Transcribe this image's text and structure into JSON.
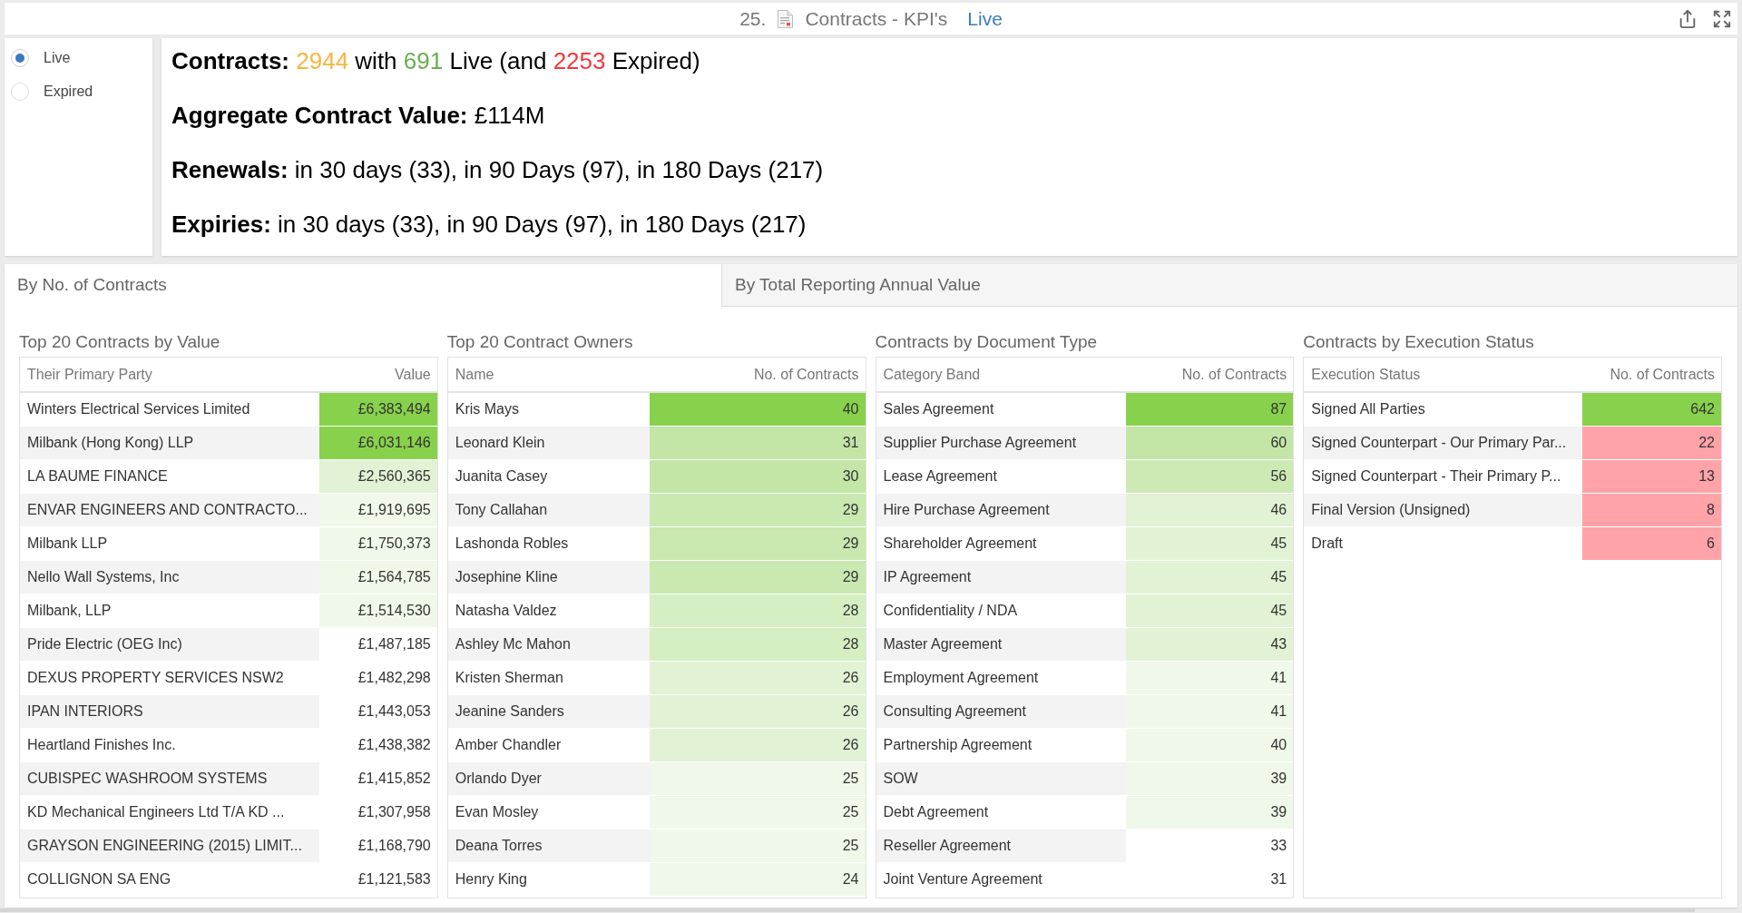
{
  "title_bar": {
    "number": "25.",
    "title": "Contracts - KPI's",
    "status": "Live"
  },
  "filter": {
    "options": [
      {
        "label": "Live",
        "selected": true
      },
      {
        "label": "Expired",
        "selected": false
      }
    ]
  },
  "kpis": [
    {
      "label": "Contracts:",
      "segments": [
        {
          "text": "2944",
          "color": "#fab43d"
        },
        {
          "text": "with"
        },
        {
          "text": "691",
          "color": "#66b04e"
        },
        {
          "text": "Live (and"
        },
        {
          "text": "2253",
          "color": "#f2383e"
        },
        {
          "text": "Expired)"
        }
      ]
    },
    {
      "label": "Aggregate Contract Value:",
      "segments": [
        {
          "text": "£114M"
        }
      ]
    },
    {
      "label": "Renewals:",
      "segments": [
        {
          "text": "in 30 days (33), in 90 Days (97), in 180 Days (217)"
        }
      ]
    },
    {
      "label": "Expiries:",
      "segments": [
        {
          "text": "in 30 days (33), in 90 Days (97), in 180 Days (217)"
        }
      ]
    }
  ],
  "tabs": [
    {
      "label": "By No. of Contracts",
      "selected": true
    },
    {
      "label": "By Total Reporting Annual Value",
      "selected": false
    }
  ],
  "tables": [
    {
      "title": "Top 20 Contracts by Value",
      "columns": [
        "Their Primary Party",
        "Value"
      ],
      "rows": [
        {
          "name": "Winters Electrical Services Limited",
          "value": "£6,383,494",
          "color": "#88d14c"
        },
        {
          "name": "Milbank (Hong Kong) LLP",
          "value": "£6,031,146",
          "color": "#88d14c"
        },
        {
          "name": "LA BAUME FINANCE",
          "value": "£2,560,365",
          "color": "#e2f3d5"
        },
        {
          "name": "ENVAR ENGINEERS AND CONTRACTO...",
          "value": "£1,919,695",
          "color": "#f0f9e9"
        },
        {
          "name": "Milbank LLP",
          "value": "£1,750,373",
          "color": "#f0f9e9"
        },
        {
          "name": "Nello Wall Systems, Inc",
          "value": "£1,564,785",
          "color": "#f0f9e9"
        },
        {
          "name": "Milbank, LLP",
          "value": "£1,514,530",
          "color": "#f0f9e9"
        },
        {
          "name": "Pride Electric (OEG Inc)",
          "value": "£1,487,185"
        },
        {
          "name": "DEXUS PROPERTY SERVICES NSW2",
          "value": "£1,482,298"
        },
        {
          "name": "IPAN INTERIORS",
          "value": "£1,443,053"
        },
        {
          "name": "Heartland Finishes Inc.",
          "value": "£1,438,382"
        },
        {
          "name": "CUBISPEC WASHROOM SYSTEMS",
          "value": "£1,415,852"
        },
        {
          "name": "KD Mechanical Engineers Ltd T/A KD ...",
          "value": "£1,307,958"
        },
        {
          "name": "GRAYSON ENGINEERING (2015) LIMIT...",
          "value": "£1,168,790"
        },
        {
          "name": "COLLIGNON SA ENG",
          "value": "£1,121,583"
        }
      ]
    },
    {
      "title": "Top 20 Contract Owners",
      "columns": [
        "Name",
        "No. of Contracts"
      ],
      "rows": [
        {
          "name": "Kris Mays",
          "value": "40",
          "color": "#88d14c"
        },
        {
          "name": "Leonard Klein",
          "value": "31",
          "color": "#c3e6a6"
        },
        {
          "name": "Juanita Casey",
          "value": "30",
          "color": "#c3e6a6"
        },
        {
          "name": "Tony Callahan",
          "value": "29",
          "color": "#c9e9b0"
        },
        {
          "name": "Lashonda Robles",
          "value": "29",
          "color": "#c9e9b0"
        },
        {
          "name": "Josephine Kline",
          "value": "29",
          "color": "#c9e9b0"
        },
        {
          "name": "Natasha Valdez",
          "value": "28",
          "color": "#d5efc2"
        },
        {
          "name": "Ashley Mc Mahon",
          "value": "28",
          "color": "#d5efc2"
        },
        {
          "name": "Kristen Sherman",
          "value": "26",
          "color": "#e2f3d5"
        },
        {
          "name": "Jeanine Sanders",
          "value": "26",
          "color": "#e2f3d5"
        },
        {
          "name": "Amber Chandler",
          "value": "26",
          "color": "#e2f3d5"
        },
        {
          "name": "Orlando Dyer",
          "value": "25",
          "color": "#f0f9e9"
        },
        {
          "name": "Evan Mosley",
          "value": "25",
          "color": "#f0f9e9"
        },
        {
          "name": "Deana Torres",
          "value": "25",
          "color": "#f0f9e9"
        },
        {
          "name": "Henry King",
          "value": "24",
          "color": "#f0f9e9"
        }
      ]
    },
    {
      "title": "Contracts by Document Type",
      "columns": [
        "Category Band",
        "No. of Contracts"
      ],
      "rows": [
        {
          "name": "Sales Agreement",
          "value": "87",
          "color": "#88d14c"
        },
        {
          "name": "Supplier Purchase Agreement",
          "value": "60",
          "color": "#c3e6a6"
        },
        {
          "name": "Lease Agreement",
          "value": "56",
          "color": "#cdeab5"
        },
        {
          "name": "Hire Purchase Agreement",
          "value": "46",
          "color": "#e2f3d5"
        },
        {
          "name": "Shareholder Agreement",
          "value": "45",
          "color": "#e2f3d5"
        },
        {
          "name": "IP Agreement",
          "value": "45",
          "color": "#e2f3d5"
        },
        {
          "name": "Confidentiality / NDA",
          "value": "45",
          "color": "#e2f3d5"
        },
        {
          "name": "Master Agreement",
          "value": "43",
          "color": "#e2f3d5"
        },
        {
          "name": "Employment Agreement",
          "value": "41",
          "color": "#f0f9e9"
        },
        {
          "name": "Consulting Agreement",
          "value": "41",
          "color": "#f0f9e9"
        },
        {
          "name": "Partnership Agreement",
          "value": "40",
          "color": "#f0f9e9"
        },
        {
          "name": "SOW",
          "value": "39",
          "color": "#f0f9e9"
        },
        {
          "name": "Debt Agreement",
          "value": "39",
          "color": "#f0f9e9"
        },
        {
          "name": "Reseller Agreement",
          "value": "33"
        },
        {
          "name": "Joint Venture Agreement",
          "value": "31"
        }
      ]
    },
    {
      "title": "Contracts by Execution Status",
      "columns": [
        "Execution Status",
        "No. of Contracts"
      ],
      "rows": [
        {
          "name": "Signed All Parties",
          "value": "642",
          "color": "#88d14c"
        },
        {
          "name": "Signed Counterpart - Our Primary Par...",
          "value": "22",
          "color": "#ffa3a9"
        },
        {
          "name": "Signed Counterpart - Their Primary P...",
          "value": "13",
          "color": "#ffa3a9"
        },
        {
          "name": "Final Version (Unsigned)",
          "value": "8",
          "color": "#ffa3a9"
        },
        {
          "name": "Draft",
          "value": "6",
          "color": "#ffa3a9"
        }
      ]
    }
  ]
}
